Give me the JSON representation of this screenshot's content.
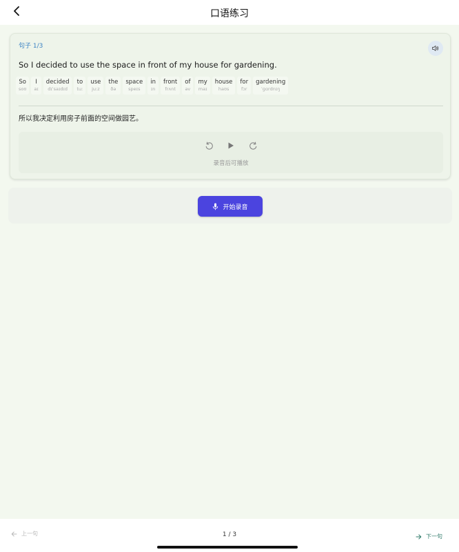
{
  "header": {
    "title": "口语练习"
  },
  "card": {
    "sentence_index": "句子 1/3",
    "sentence": "So I decided to use the space in front of my house for gardening.",
    "words": [
      {
        "word": "So",
        "phonetic": "soʊ"
      },
      {
        "word": "I",
        "phonetic": "aɪ"
      },
      {
        "word": "decided",
        "phonetic": "dɪˈsaɪdɪd"
      },
      {
        "word": "to",
        "phonetic": "tuː"
      },
      {
        "word": "use",
        "phonetic": "juːz"
      },
      {
        "word": "the",
        "phonetic": "ðə"
      },
      {
        "word": "space",
        "phonetic": "speɪs"
      },
      {
        "word": "in",
        "phonetic": "ɪn"
      },
      {
        "word": "front",
        "phonetic": "frʌnt"
      },
      {
        "word": "of",
        "phonetic": "əv"
      },
      {
        "word": "my",
        "phonetic": "maɪ"
      },
      {
        "word": "house",
        "phonetic": "haʊs"
      },
      {
        "word": "for",
        "phonetic": "fɔr"
      },
      {
        "word": "gardening",
        "phonetic": "ˈɡɑrdnɪŋ"
      }
    ],
    "translation": "所以我决定利用房子前面的空间做园艺。",
    "player_hint": "录音后可播放"
  },
  "record": {
    "button_label": "开始录音"
  },
  "footer": {
    "prev_label": "上一句",
    "page_count": "1 / 3",
    "next_label": "下一句"
  },
  "icons": {
    "back": "chevron-left-icon",
    "speaker": "speaker-icon",
    "replay_back": "rewind-icon",
    "play": "play-icon",
    "replay_forward": "forward-icon",
    "mic": "microphone-icon",
    "prev": "arrow-left-icon",
    "next": "arrow-right-icon"
  },
  "colors": {
    "accent": "#4b44df",
    "index_blue": "#3b82c4",
    "next_green": "#2f7a6a"
  }
}
